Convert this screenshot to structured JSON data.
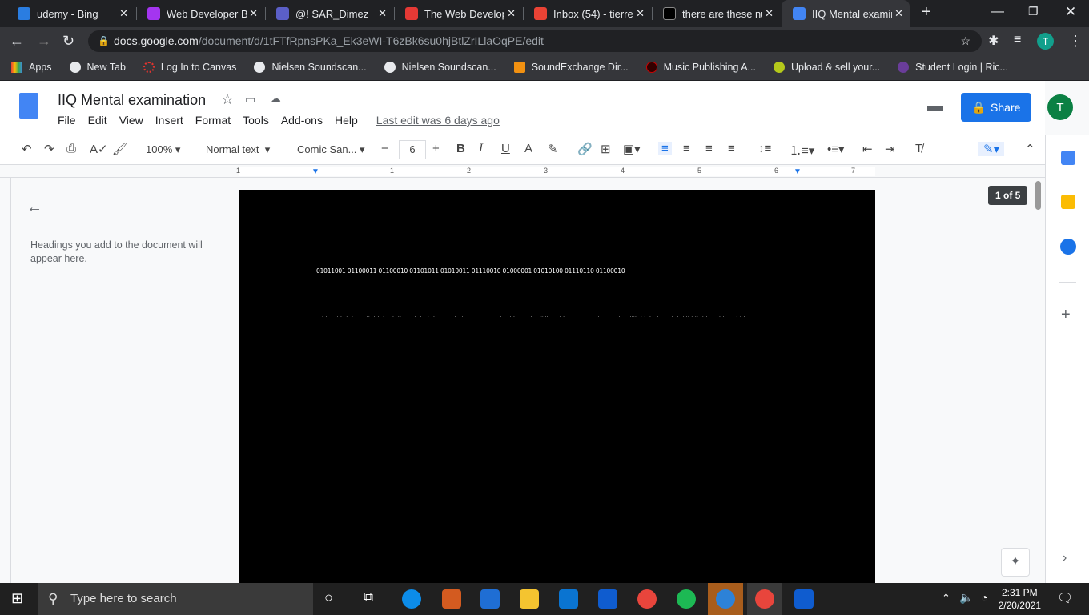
{
  "browser": {
    "tabs": [
      {
        "label": "udemy - Bing",
        "color": "#2a7de1"
      },
      {
        "label": "Web Developer Bo",
        "color": "#a435f0"
      },
      {
        "label": "@! SAR_Dimez",
        "color": "#5b5fc7"
      },
      {
        "label": "The Web Develope",
        "color": "#e53935"
      },
      {
        "label": "Inbox (54) - tierre",
        "color": "#ea4335"
      },
      {
        "label": "there are these nu",
        "color": "#000000"
      },
      {
        "label": "IIQ Mental examin",
        "color": "#4285f4"
      }
    ],
    "url_domain": "docs.google.com",
    "url_path": "/document/d/1tFTfRpnsPKa_Ek3eWI-T6zBk6su0hjBtlZrILlaOqPE/edit",
    "profile_initial": "T",
    "bookmarks": [
      "Apps",
      "New Tab",
      "Log In to Canvas",
      "Nielsen Soundscan...",
      "Nielsen Soundscan...",
      "SoundExchange Dir...",
      "Music Publishing A...",
      "Upload & sell your...",
      "Student Login | Ric..."
    ]
  },
  "doc": {
    "title": "IIQ Mental examination",
    "menu": [
      "File",
      "Edit",
      "View",
      "Insert",
      "Format",
      "Tools",
      "Add-ons",
      "Help"
    ],
    "last_edit": "Last edit was 6 days ago",
    "share": "Share",
    "user_initial": "T",
    "toolbar": {
      "zoom": "100%",
      "style": "Normal text",
      "font": "Comic San...",
      "size": "6"
    },
    "ruler": [
      "1",
      "1",
      "2",
      "3",
      "4",
      "5",
      "6",
      "7"
    ],
    "outline_hint": "Headings you add to the document will appear here.",
    "page_count": "1 of 5",
    "binary_line": "01011001 01100011 01100010 01101011 01010011 01110010 01000001 01010100 01110110 01100010",
    "morse_line": "-.-. .--- -. .--. -.- -.- -.. -.-. -.-- -. -.. .--- -.- .-- .--.-- ----- -.-- .--- .-- ----- --- -.- --. . ----- -. -- ...... -- -. .--- ----- -- --- . ----- -- .--- ..... -. . -.- -. - .-- . -.- .... .-.. -.-. --- -.-.- --- .-.-."
  },
  "taskbar": {
    "search_placeholder": "Type here to search",
    "time": "2:31 PM",
    "date": "2/20/2021"
  }
}
